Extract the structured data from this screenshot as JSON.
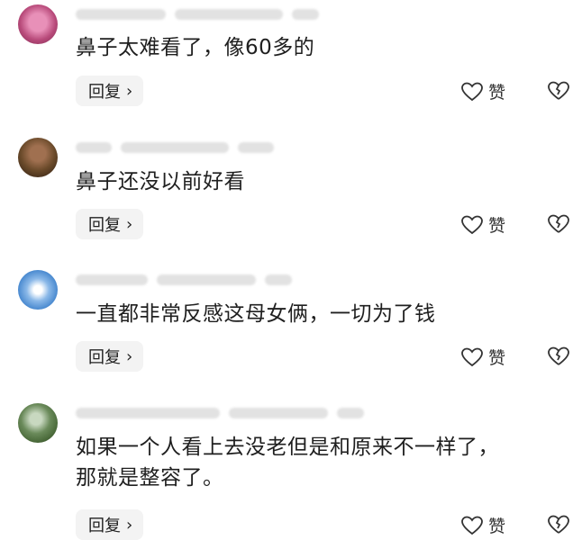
{
  "comments": [
    {
      "text_lines": [
        "鼻子太难看了，像60多的"
      ],
      "reply_label": "回复",
      "like_label": "赞"
    },
    {
      "text_lines": [
        "鼻子还没以前好看"
      ],
      "reply_label": "回复",
      "like_label": "赞"
    },
    {
      "text_lines": [
        "一直都非常反感这母女俩，一切为了钱"
      ],
      "reply_label": "回复",
      "like_label": "赞"
    },
    {
      "text_lines": [
        "如果一个人看上去没老但是和原来不一样了，",
        "那就是整容了。"
      ],
      "reply_label": "回复",
      "like_label": "赞"
    }
  ],
  "colors": {
    "avatar_1": "#b84a7a",
    "avatar_2": "#6a4a2a",
    "avatar_3": "#4a8ad0",
    "avatar_4": "#4a6a3a"
  }
}
